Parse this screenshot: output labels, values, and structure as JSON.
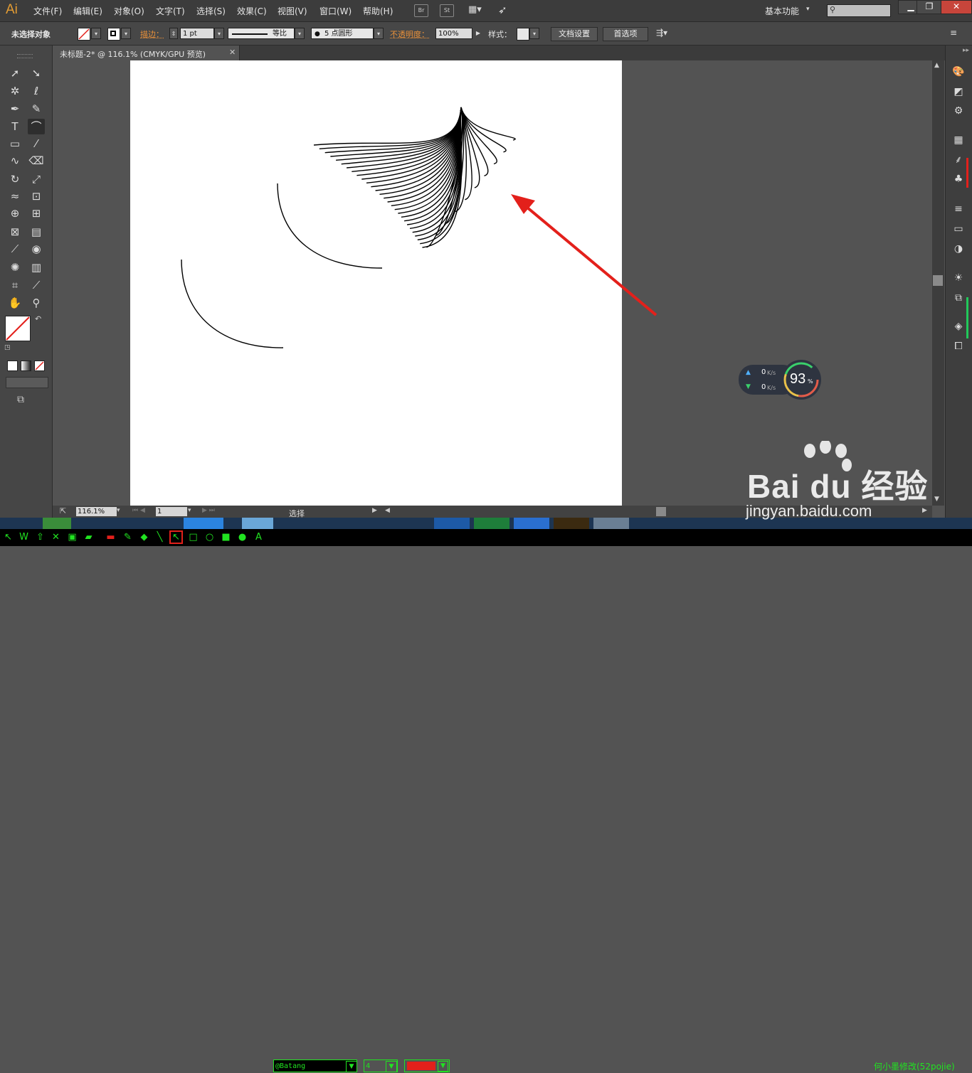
{
  "app": {
    "logo": "Ai"
  },
  "menu": {
    "items": [
      "文件(F)",
      "编辑(E)",
      "对象(O)",
      "文字(T)",
      "选择(S)",
      "效果(C)",
      "视图(V)",
      "窗口(W)",
      "帮助(H)"
    ],
    "bridge_label": "Br",
    "stock_label": "St",
    "workspace": "基本功能"
  },
  "control_bar": {
    "selection_status": "未选择对象",
    "stroke_label": "描边：",
    "stroke_weight": "1 pt",
    "profile_label": "等比",
    "brush_label": "5 点圆形",
    "opacity_label": "不透明度：",
    "opacity_value": "100%",
    "style_label": "样式：",
    "doc_setup_button": "文档设置",
    "preferences_button": "首选项"
  },
  "document": {
    "tab_title": "未标题-2* @ 116.1% (CMYK/GPU 预览)",
    "close_glyph": "✕"
  },
  "status_bar": {
    "zoom": "116.1%",
    "page": "1",
    "mode": "选择"
  },
  "net_widget": {
    "upload": "0",
    "download": "0",
    "unit": "K/s",
    "percent": "93",
    "percent_sign": "%"
  },
  "bottom_bar": {
    "font": "@Batang",
    "size": "4",
    "credit": "何小墨修改(52pojie)"
  },
  "watermark": {
    "brand": "Bai du 经验",
    "url": "jingyan.baidu.com"
  },
  "colors": {
    "ai_orange": "#e39c33",
    "arrow_red": "#e3201b",
    "bottom_green": "#21e321"
  }
}
